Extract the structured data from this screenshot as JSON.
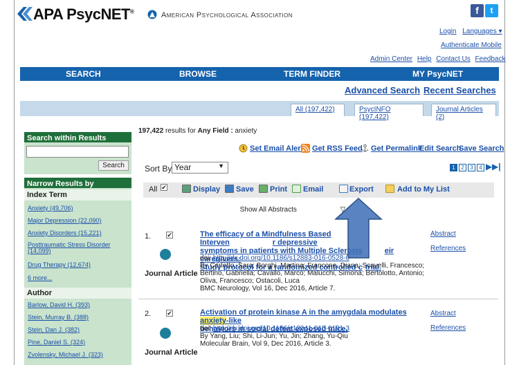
{
  "header": {
    "logo_text": "APA PsycNET",
    "logo_reg": "®",
    "apa_name": "American Psychological Association",
    "social": {
      "facebook": "f",
      "twitter": "t"
    },
    "links_row1": {
      "login": "Login",
      "languages": "Languages ▾"
    },
    "links_row2": {
      "authenticate_mobile": "Authenticate Mobile"
    },
    "links_row3": {
      "admin_center": "Admin Center",
      "help": "Help",
      "contact_us": "Contact Us",
      "feedback": "Feedback"
    }
  },
  "nav": {
    "search": "SEARCH",
    "browse": "BROWSE",
    "term_finder": "TERM FINDER",
    "my_psycnet": "MY PsycNET"
  },
  "subnav": {
    "advanced_search": "Advanced Search",
    "recent_searches": "Recent Searches"
  },
  "tabs": [
    {
      "label": "All (197,422)"
    },
    {
      "label": "PsycINFO (197,422)"
    },
    {
      "label": "Journal Articles (2)"
    }
  ],
  "sidebar": {
    "search_within_title": "Search within Results",
    "search_within_value": "",
    "search_button": "Search",
    "narrow_title": "Narrow Results by",
    "index_term_title": "Index Term",
    "index_terms": [
      {
        "label": "Anxiety (49,706)"
      },
      {
        "label": "Major Depression (22,090)"
      },
      {
        "label": "Anxiety Disorders (15,221)"
      },
      {
        "label": "Posttraumatic Stress Disorder"
      },
      {
        "label": "(14,099)"
      },
      {
        "label": "Drug Therapy (12,674)"
      },
      {
        "label": "6 more..."
      }
    ],
    "author_title": "Author",
    "authors": [
      {
        "label": "Barlow, David H. (393)"
      },
      {
        "label": "Stein, Murray B. (388)"
      },
      {
        "label": "Stein, Dan J. (382)"
      },
      {
        "label": "Pine, Daniel S. (324)"
      },
      {
        "label": "Zvolensky, Michael J. (323)"
      }
    ]
  },
  "results_header": {
    "count": "197,422",
    "results_for": "results for",
    "field": "Any Field :",
    "query": "anxiety"
  },
  "toolbar": {
    "set_email_alert": "Set Email Alert",
    "get_rss_feed": "Get RSS Feed",
    "get_permalink": "Get Permalink",
    "edit_search": "Edit Search",
    "save_search": "Save Search"
  },
  "sort": {
    "label": "Sort By",
    "value": "Year"
  },
  "pager": {
    "pages": [
      "1",
      "2",
      "3",
      "4"
    ],
    "current": "1"
  },
  "actions": {
    "all": "All",
    "display": "Display",
    "save": "Save",
    "print": "Print",
    "email": "Email",
    "export": "Export",
    "add_to_list": "Add to My List"
  },
  "show_all_abstracts": "Show All Abstracts",
  "results": [
    {
      "num": "1.",
      "title_l1": "The efficacy of a Mindfulness Based Interven",
      "title_l1_tail": "r depressive",
      "title_l2": "symptoms in patients with Multiple Sclerosis",
      "title_l2_tail": "eir caregivers:",
      "title_l3": "Study protocol for a randomized controlled c",
      "title_l3_tail": "trial.",
      "doi_label": "doi:",
      "doi": "http://dx.doi.org/10.1186/s12883-016-0528-0",
      "authors": "By Carletto, Sara; Borghi, Martina; Francone, Diana; Scavelli, Francesco; Bertino, Gabriella; Cavallo, Marco; Malucchi, Simona; Bertolotto, Antonio; Oliva, Francesco; Ostacoli, Luca",
      "source": "BMC Neurology, Vol 16, Dec 2016, Article 7.",
      "type": "Journal Article",
      "side_abstract": "Abstract",
      "side_references": "References"
    },
    {
      "num": "2.",
      "title_l1_pre": "Activation of protein kinase A in the amygdala modulates ",
      "title_l1_hl": "anxiety",
      "title_l1_post": "-like",
      "title_l2": "behaviors in social defeat exposed mice.",
      "doi_label": "doi:",
      "doi": "http://dx.doi.org/10.1186/s13041-015-0181-3",
      "authors": "By Yang, Liu; Shi, Li-Jun; Yu, Jin; Zhang, Yu-Qiu",
      "source": "Molecular Brain, Vol 9, Dec 2016, Article 3.",
      "type": "Journal Article",
      "side_abstract": "Abstract",
      "side_references": "References"
    }
  ],
  "colors": {
    "nav_blue": "#1663ad",
    "sidebar_green": "#1f6f3a",
    "link_blue": "#1a4fa8",
    "annotation_arrow": "#3d6fb6"
  }
}
